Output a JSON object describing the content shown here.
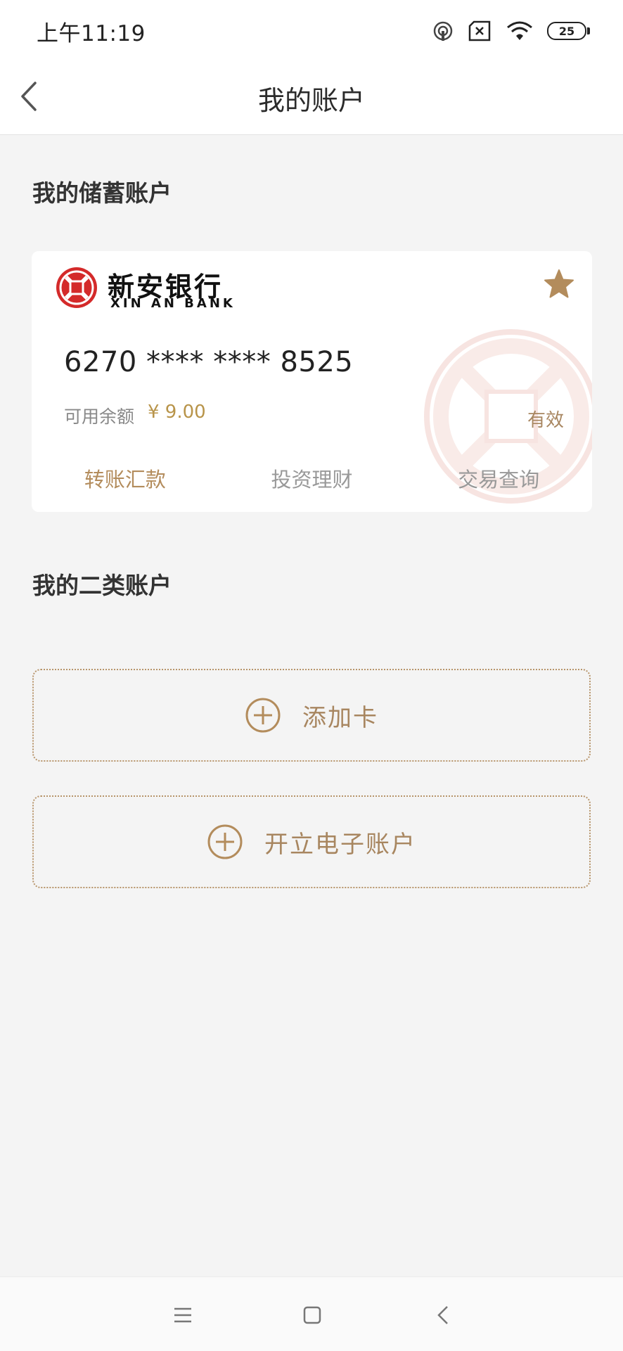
{
  "status_bar": {
    "time": "上午11:19",
    "battery": "25",
    "icons": [
      "hotspot-icon",
      "sim-error-icon",
      "wifi-icon",
      "battery-icon"
    ]
  },
  "header": {
    "title": "我的账户"
  },
  "savings_section": {
    "title": "我的储蓄账户",
    "card": {
      "bank_name_cn": "新安银行",
      "bank_name_en": "XIN AN BANK",
      "card_number": "6270 **** **** 8525",
      "balance_label": "可用余额",
      "balance_value": "¥ 9.00",
      "status": "有效",
      "actions": [
        {
          "label": "转账汇款"
        },
        {
          "label": "投资理财"
        },
        {
          "label": "交易查询"
        }
      ]
    }
  },
  "class2_section": {
    "title": "我的二类账户",
    "add_card_label": "添加卡",
    "open_eaccount_label": "开立电子账户"
  },
  "colors": {
    "accent": "#b38c5c",
    "bank_red": "#d42a2a",
    "background": "#f4f4f4"
  }
}
